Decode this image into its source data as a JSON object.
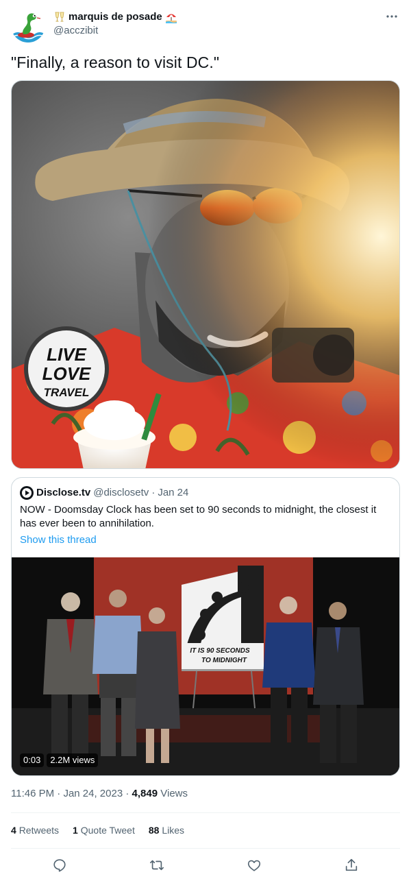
{
  "author": {
    "display_name": "marquis de posade",
    "handle": "@acczibit",
    "avatar_icon": "snake-in-water-icon",
    "name_emoji_left": "clinking-glasses-emoji",
    "name_emoji_right": "beach-umbrella-emoji"
  },
  "tweet": {
    "text": "\"Finally, a reason to visit DC.\"",
    "image_alt_text": "LIVE LOVE TRAVEL"
  },
  "quote": {
    "name": "Disclose.tv",
    "handle": "@disclosetv",
    "separator": "·",
    "date": "Jan 24",
    "text": "NOW - Doomsday Clock has been set to 90 seconds to midnight, the closest it has ever been to annihilation.",
    "show_thread": "Show this thread",
    "video": {
      "sign_line1": "IT IS 90 SECONDS",
      "sign_line2": "TO MIDNIGHT",
      "time": "0:03",
      "views": "2.2M views"
    }
  },
  "meta": {
    "time": "11:46 PM",
    "sep1": "·",
    "date": "Jan 24, 2023",
    "sep2": "·",
    "views_count": "4,849",
    "views_label": "Views"
  },
  "stats": {
    "retweets_count": "4",
    "retweets_label": "Retweets",
    "quotes_count": "1",
    "quotes_label": "Quote Tweet",
    "likes_count": "88",
    "likes_label": "Likes"
  },
  "colors": {
    "accent": "#1d9bf0",
    "secondary_text": "#536471",
    "border": "#cfd9de"
  }
}
